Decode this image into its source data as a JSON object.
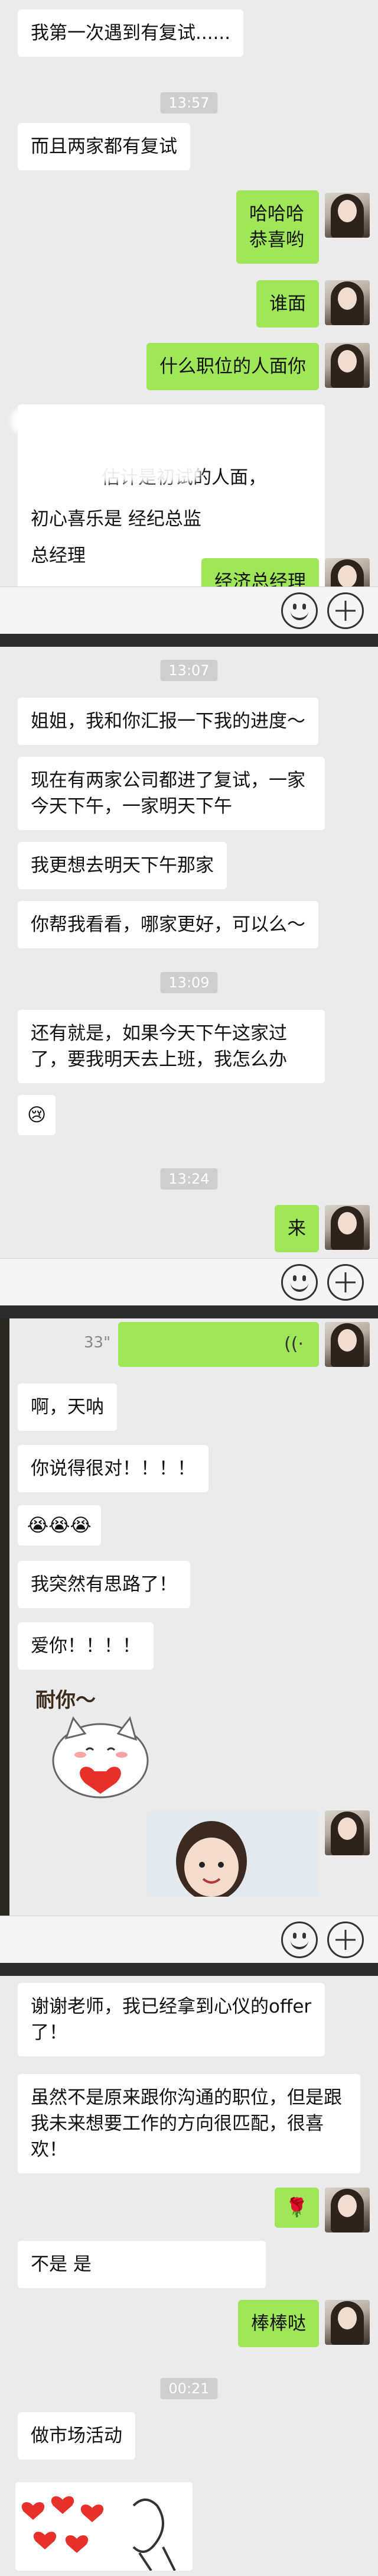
{
  "section1": {
    "msg_first_time": "我第一次遇到有复试......",
    "time1": "13:57",
    "msg_both_have": "而且两家都有复试",
    "msg_haha": "哈哈哈\n恭喜哟",
    "msg_who_interview": "谁面",
    "msg_what_position": "什么职位的人面你",
    "msg_estimate_line1": "估计是初试的人面，",
    "msg_estimate_line2": "总经理",
    "msg_chuxin": "初心喜乐是 经纪总监",
    "msg_economic_gm": "经济总经理"
  },
  "section2": {
    "time2": "13:07",
    "msg_report": "姐姐，我和你汇报一下我的进度～",
    "msg_two_companies": "现在有两家公司都进了复试，一家今天下午，一家明天下午",
    "msg_prefer": "我更想去明天下午那家",
    "msg_help": "你帮我看看，哪家更好，可以么～",
    "time3": "13:09",
    "msg_also": "还有就是，如果今天下午这家过了，要我明天去上班，我怎么办",
    "msg_cry": "😢",
    "time4": "13:24",
    "msg_come": "来"
  },
  "section3": {
    "voice_duration": "33\"",
    "voice_icon": "wifi-like-sound-icon",
    "msg_wow": "啊，天呐",
    "msg_right": "你说得很对！！！！",
    "msg_tears": "😭😭😭",
    "msg_idea": "我突然有思路了！",
    "msg_love": "爱你！！！！",
    "sticker_text": "耐你～"
  },
  "section4": {
    "msg_thanks": "谢谢老师，我已经拿到心仪的offer了！",
    "msg_although": "虽然不是原来跟你沟通的职位，但是跟我未来想要工作的方向很匹配，很喜欢！",
    "msg_rose": "🌹",
    "msg_not_is": "不是 是",
    "msg_great": "棒棒哒",
    "time5": "00:21",
    "msg_marketing": "做市场活动"
  },
  "colors": {
    "background": "#ebebeb",
    "bubble_out": "#9fe658",
    "bubble_in": "#ffffff",
    "divider": "#2c2c2c"
  }
}
